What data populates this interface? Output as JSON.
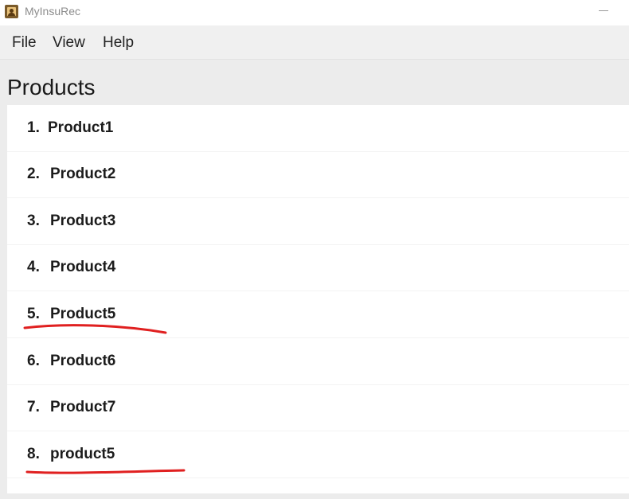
{
  "window": {
    "title": "MyInsuRec"
  },
  "menu": {
    "items": [
      "File",
      "View",
      "Help"
    ]
  },
  "page": {
    "title": "Products"
  },
  "products": [
    {
      "index": "1.",
      "name": "Product1"
    },
    {
      "index": "2.",
      "name": "Product2"
    },
    {
      "index": "3.",
      "name": "Product3"
    },
    {
      "index": "4.",
      "name": "Product4"
    },
    {
      "index": "5.",
      "name": "Product5"
    },
    {
      "index": "6.",
      "name": "Product6"
    },
    {
      "index": "7.",
      "name": "Product7"
    },
    {
      "index": "8.",
      "name": "product5"
    }
  ],
  "annotations": {
    "color": "#e02020"
  }
}
